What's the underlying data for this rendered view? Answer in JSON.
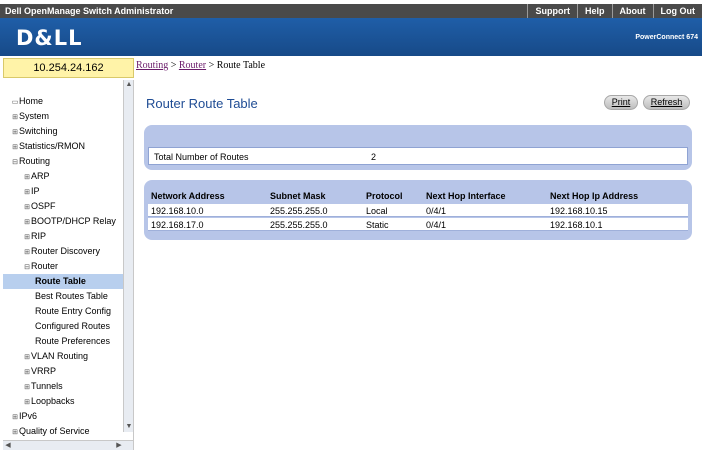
{
  "topbar": {
    "title": "Dell OpenManage Switch Administrator",
    "links": [
      "Support",
      "Help",
      "About",
      "Log Out"
    ]
  },
  "header": {
    "logo": "D&LL",
    "product": "PowerConnect 674"
  },
  "ip_address": "10.254.24.162",
  "breadcrumb": {
    "link1": "Routing",
    "sep1": " > ",
    "link2": "Router",
    "sep2": " > ",
    "current": "Route Table"
  },
  "sidebar": {
    "items": [
      {
        "label": "Home",
        "icon": "home-icon",
        "indent": 0
      },
      {
        "label": "System",
        "icon": "expand-icon",
        "indent": 0
      },
      {
        "label": "Switching",
        "icon": "expand-icon",
        "indent": 0
      },
      {
        "label": "Statistics/RMON",
        "icon": "expand-icon",
        "indent": 0
      },
      {
        "label": "Routing",
        "icon": "collapse-icon",
        "indent": 0
      },
      {
        "label": "ARP",
        "icon": "expand-icon",
        "indent": 1
      },
      {
        "label": "IP",
        "icon": "expand-icon",
        "indent": 1
      },
      {
        "label": "OSPF",
        "icon": "expand-icon",
        "indent": 1
      },
      {
        "label": "BOOTP/DHCP Relay",
        "icon": "expand-icon",
        "indent": 1
      },
      {
        "label": "RIP",
        "icon": "expand-icon",
        "indent": 1
      },
      {
        "label": "Router Discovery",
        "icon": "expand-icon",
        "indent": 1
      },
      {
        "label": "Router",
        "icon": "collapse-icon",
        "indent": 1
      },
      {
        "label": "Route Table",
        "icon": "",
        "indent": 2,
        "selected": true
      },
      {
        "label": "Best Routes Table",
        "icon": "",
        "indent": 2
      },
      {
        "label": "Route Entry Config",
        "icon": "",
        "indent": 2
      },
      {
        "label": "Configured Routes",
        "icon": "",
        "indent": 2
      },
      {
        "label": "Route Preferences",
        "icon": "",
        "indent": 2
      },
      {
        "label": "VLAN Routing",
        "icon": "expand-icon",
        "indent": 1
      },
      {
        "label": "VRRP",
        "icon": "expand-icon",
        "indent": 1
      },
      {
        "label": "Tunnels",
        "icon": "expand-icon",
        "indent": 1
      },
      {
        "label": "Loopbacks",
        "icon": "expand-icon",
        "indent": 1
      },
      {
        "label": "IPv6",
        "icon": "expand-icon",
        "indent": 0
      },
      {
        "label": "Quality of Service",
        "icon": "expand-icon",
        "indent": 0
      }
    ]
  },
  "main": {
    "title": "Router Route Table",
    "print_label": "Print",
    "refresh_label": "Refresh",
    "summary": {
      "label": "Total Number of Routes",
      "value": "2"
    },
    "table": {
      "headers": [
        "Network Address",
        "Subnet Mask",
        "Protocol",
        "Next Hop Interface",
        "Next Hop Ip Address"
      ],
      "rows": [
        [
          "192.168.10.0",
          "255.255.255.0",
          "Local",
          "0/4/1",
          "192.168.10.15"
        ],
        [
          "192.168.17.0",
          "255.255.255.0",
          "Static",
          "0/4/1",
          "192.168.10.1"
        ]
      ]
    }
  },
  "colors": {
    "header_blue": "#1f5ea8",
    "panel": "#b7c5e8",
    "title": "#1f4c94",
    "ip_box": "#fff3a8",
    "selected": "#b8cfee"
  }
}
